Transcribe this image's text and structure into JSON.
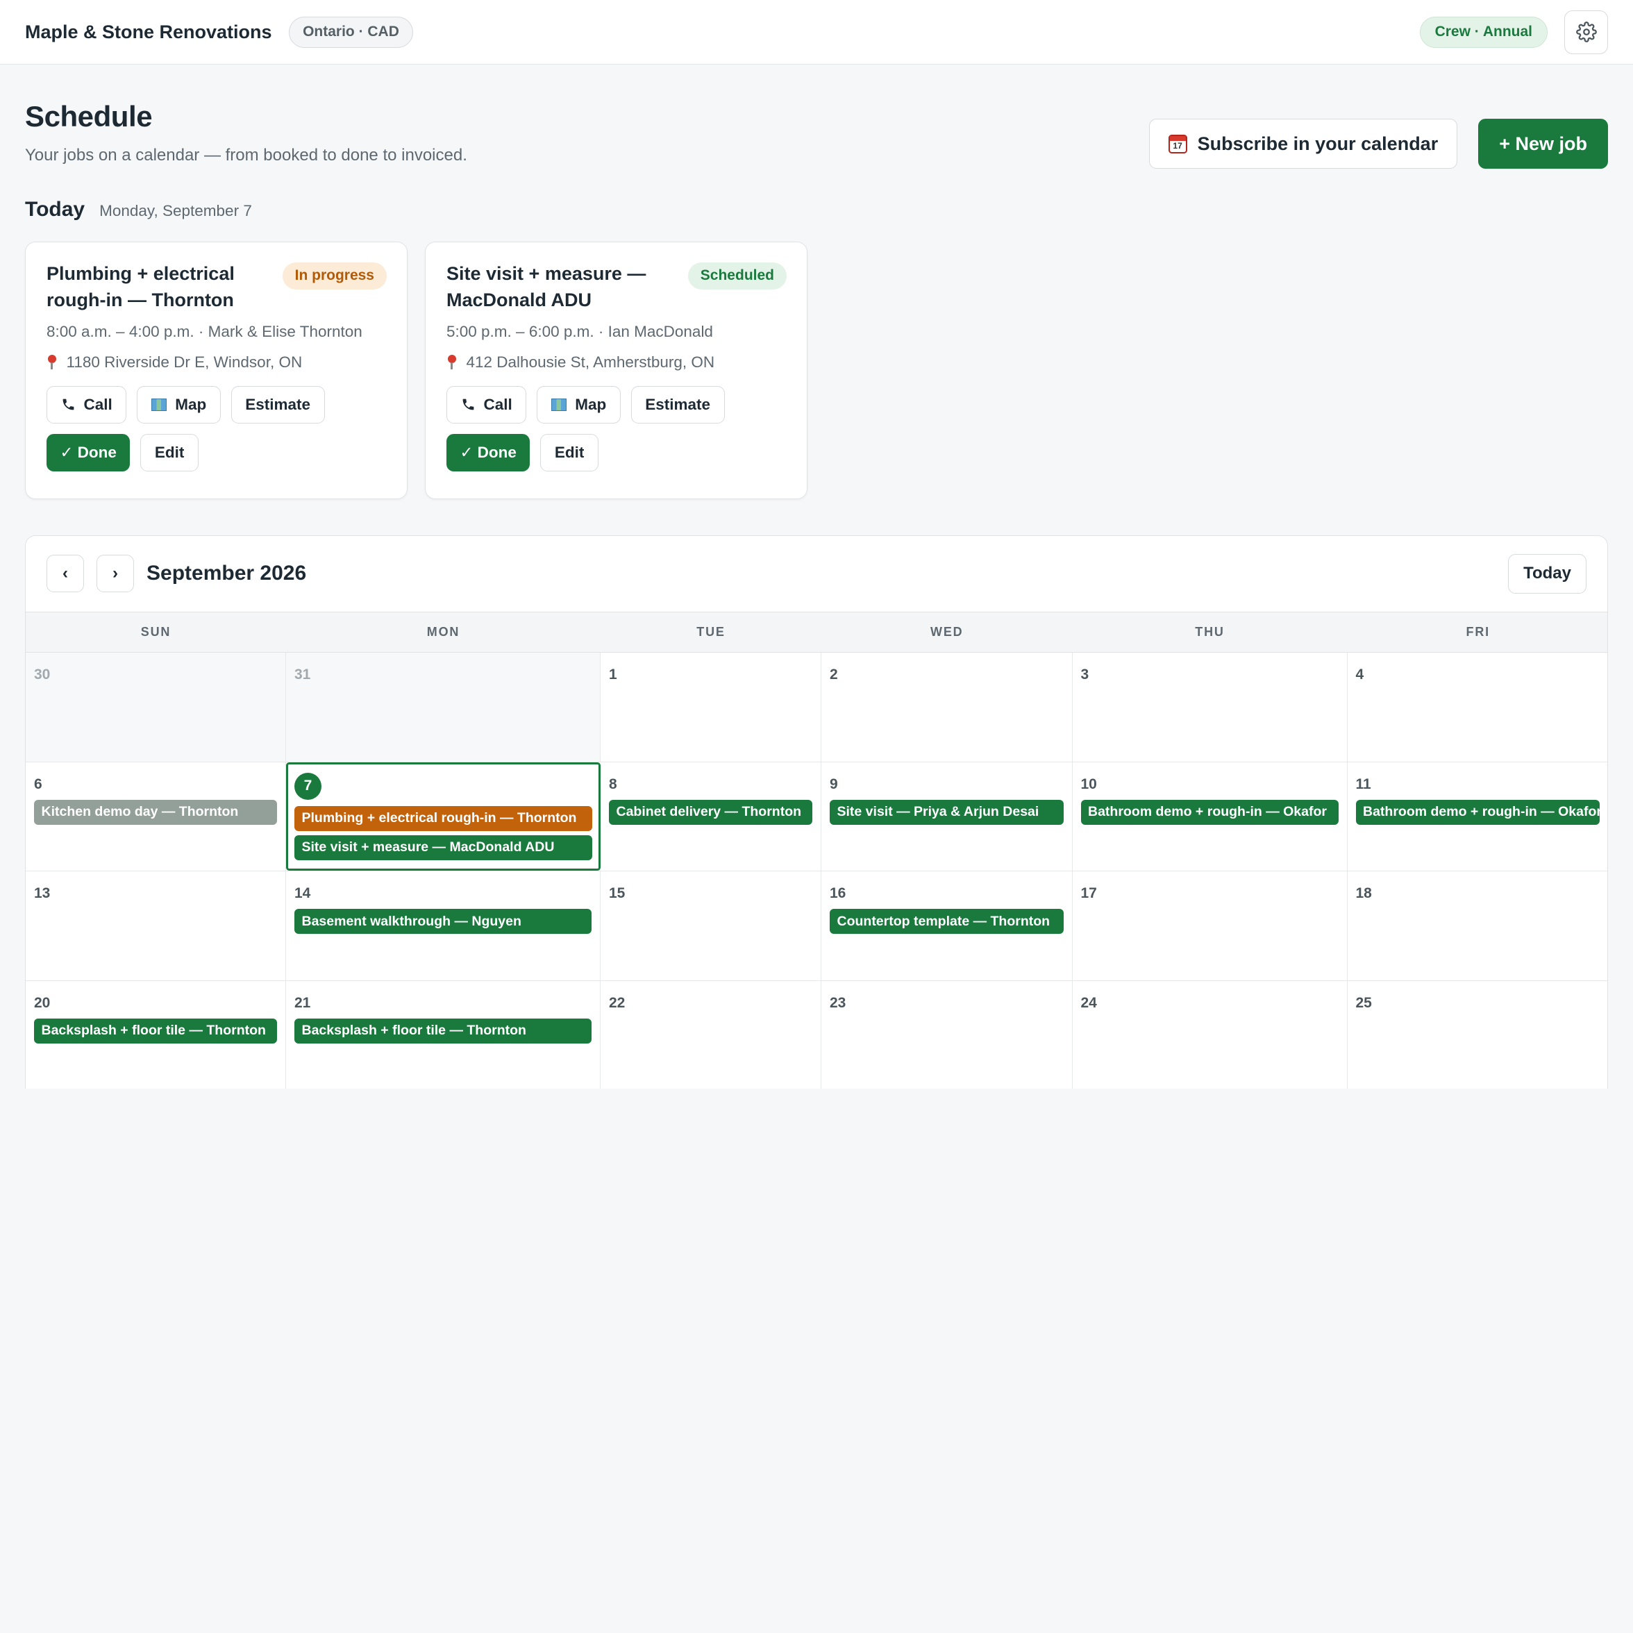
{
  "app": {
    "brand": "Maple & Stone Renovations",
    "region": "Ontario · CAD",
    "plan": "Crew · Annual"
  },
  "header": {
    "title": "Schedule",
    "subtitle": "Your jobs on a calendar — from booked to done to invoiced.",
    "subscribe_label": "Subscribe in your calendar",
    "new_job_label": "+ New job"
  },
  "today": {
    "label": "Today",
    "date": "Monday, September 7",
    "jobs": [
      {
        "title": "Plumbing + electrical rough-in — Thornton",
        "status": "In progress",
        "meta": "8:00 a.m. – 4:00 p.m. · Mark & Elise Thornton",
        "address": "1180 Riverside Dr E, Windsor, ON",
        "call": "Call",
        "map": "Map",
        "estimate": "Estimate",
        "done": "✓ Done",
        "edit": "Edit"
      },
      {
        "title": "Site visit + measure — MacDonald ADU",
        "status": "Scheduled",
        "meta": "5:00 p.m. – 6:00 p.m. · Ian MacDonald",
        "address": "412 Dalhousie St, Amherstburg, ON",
        "call": "Call",
        "map": "Map",
        "estimate": "Estimate",
        "done": "✓ Done",
        "edit": "Edit"
      }
    ]
  },
  "calendar": {
    "month": "September 2026",
    "prev": "‹",
    "next": "›",
    "today_btn": "Today",
    "weekdays": [
      "SUN",
      "MON",
      "TUE",
      "WED",
      "THU",
      "FRI"
    ],
    "weeks": [
      [
        {
          "day": "30",
          "muted": true,
          "events": []
        },
        {
          "day": "31",
          "muted": true,
          "events": []
        },
        {
          "day": "1",
          "events": []
        },
        {
          "day": "2",
          "events": []
        },
        {
          "day": "3",
          "events": []
        },
        {
          "day": "4",
          "events": []
        }
      ],
      [
        {
          "day": "6",
          "events": [
            {
              "label": "Kitchen demo day — Thornton",
              "tone": "gray"
            }
          ]
        },
        {
          "day": "7",
          "today": true,
          "events": [
            {
              "label": "Plumbing + electrical rough-in — Thornton",
              "tone": "orange"
            },
            {
              "label": "Site visit + measure — MacDonald ADU",
              "tone": "green"
            }
          ]
        },
        {
          "day": "8",
          "events": [
            {
              "label": "Cabinet delivery — Thornton",
              "tone": "green"
            }
          ]
        },
        {
          "day": "9",
          "events": [
            {
              "label": "Site visit — Priya & Arjun Desai",
              "tone": "green"
            }
          ]
        },
        {
          "day": "10",
          "events": [
            {
              "label": "Bathroom demo + rough-in — Okafor",
              "tone": "green"
            }
          ]
        },
        {
          "day": "11",
          "events": [
            {
              "label": "Bathroom demo + rough-in — Okafor",
              "tone": "green"
            }
          ]
        }
      ],
      [
        {
          "day": "13",
          "events": []
        },
        {
          "day": "14",
          "events": [
            {
              "label": "Basement walkthrough — Nguyen",
              "tone": "green"
            }
          ]
        },
        {
          "day": "15",
          "events": []
        },
        {
          "day": "16",
          "events": [
            {
              "label": "Countertop template — Thornton",
              "tone": "green"
            }
          ]
        },
        {
          "day": "17",
          "events": []
        },
        {
          "day": "18",
          "events": []
        }
      ],
      [
        {
          "day": "20",
          "events": [
            {
              "label": "Backsplash + floor tile — Thornton",
              "tone": "green"
            }
          ]
        },
        {
          "day": "21",
          "events": [
            {
              "label": "Backsplash + floor tile — Thornton",
              "tone": "green"
            }
          ]
        },
        {
          "day": "22",
          "events": []
        },
        {
          "day": "23",
          "events": []
        },
        {
          "day": "24",
          "events": []
        },
        {
          "day": "25",
          "events": []
        }
      ]
    ]
  }
}
